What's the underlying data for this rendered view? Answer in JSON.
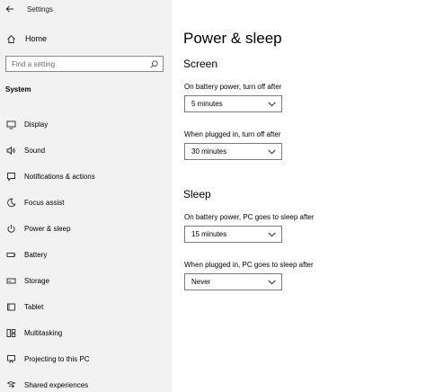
{
  "window": {
    "title": "Settings"
  },
  "sidebar": {
    "home_label": "Home",
    "search_placeholder": "Find a setting",
    "section_label": "System",
    "items": [
      {
        "label": "Display",
        "icon": "display-icon"
      },
      {
        "label": "Sound",
        "icon": "speaker-icon"
      },
      {
        "label": "Notifications & actions",
        "icon": "notifications-icon"
      },
      {
        "label": "Focus assist",
        "icon": "moon-icon"
      },
      {
        "label": "Power & sleep",
        "icon": "power-icon"
      },
      {
        "label": "Battery",
        "icon": "battery-icon"
      },
      {
        "label": "Storage",
        "icon": "storage-icon"
      },
      {
        "label": "Tablet",
        "icon": "tablet-icon"
      },
      {
        "label": "Multitasking",
        "icon": "multitasking-icon"
      },
      {
        "label": "Projecting to this PC",
        "icon": "projecting-icon"
      },
      {
        "label": "Shared experiences",
        "icon": "shared-experiences-icon"
      }
    ]
  },
  "main": {
    "title": "Power & sleep",
    "screen": {
      "heading": "Screen",
      "battery_label": "On battery power, turn off after",
      "battery_value": "5 minutes",
      "plugged_label": "When plugged in, turn off after",
      "plugged_value": "30 minutes"
    },
    "sleep": {
      "heading": "Sleep",
      "battery_label": "On battery power, PC goes to sleep after",
      "battery_value": "15 minutes",
      "plugged_label": "When plugged in, PC goes to sleep after",
      "plugged_value": "Never"
    }
  }
}
